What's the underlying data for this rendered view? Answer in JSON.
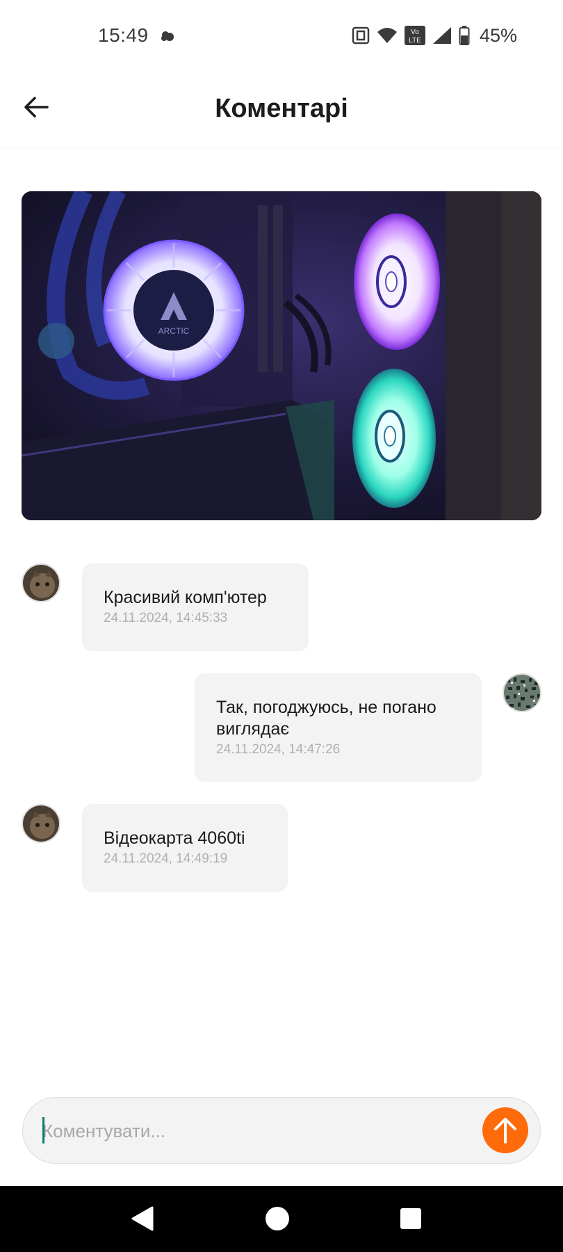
{
  "status_bar": {
    "time": "15:49",
    "battery": "45%",
    "icons": [
      "weather-cloud-icon",
      "nfc-icon",
      "wifi-icon",
      "volte-icon",
      "signal-icon",
      "battery-icon"
    ]
  },
  "header": {
    "title": "Коментарі",
    "back_icon": "arrow-left-icon"
  },
  "post": {
    "image_description_icon": "pc-case-photo"
  },
  "comments": [
    {
      "author": "other",
      "text": "Красивий комп'ютер",
      "time": "24.11.2024, 14:45:33"
    },
    {
      "author": "self",
      "text": "Так, погоджуюсь, не погано виглядає",
      "time": "24.11.2024, 14:47:26"
    },
    {
      "author": "other",
      "text": "Відеокарта 4060ti",
      "time": "24.11.2024, 14:49:19"
    }
  ],
  "input": {
    "placeholder": "Коментувати...",
    "value": ""
  },
  "colors": {
    "accent": "#ff6b0a",
    "bubble": "#f3f3f3",
    "timestamp": "#b0b0b0"
  }
}
